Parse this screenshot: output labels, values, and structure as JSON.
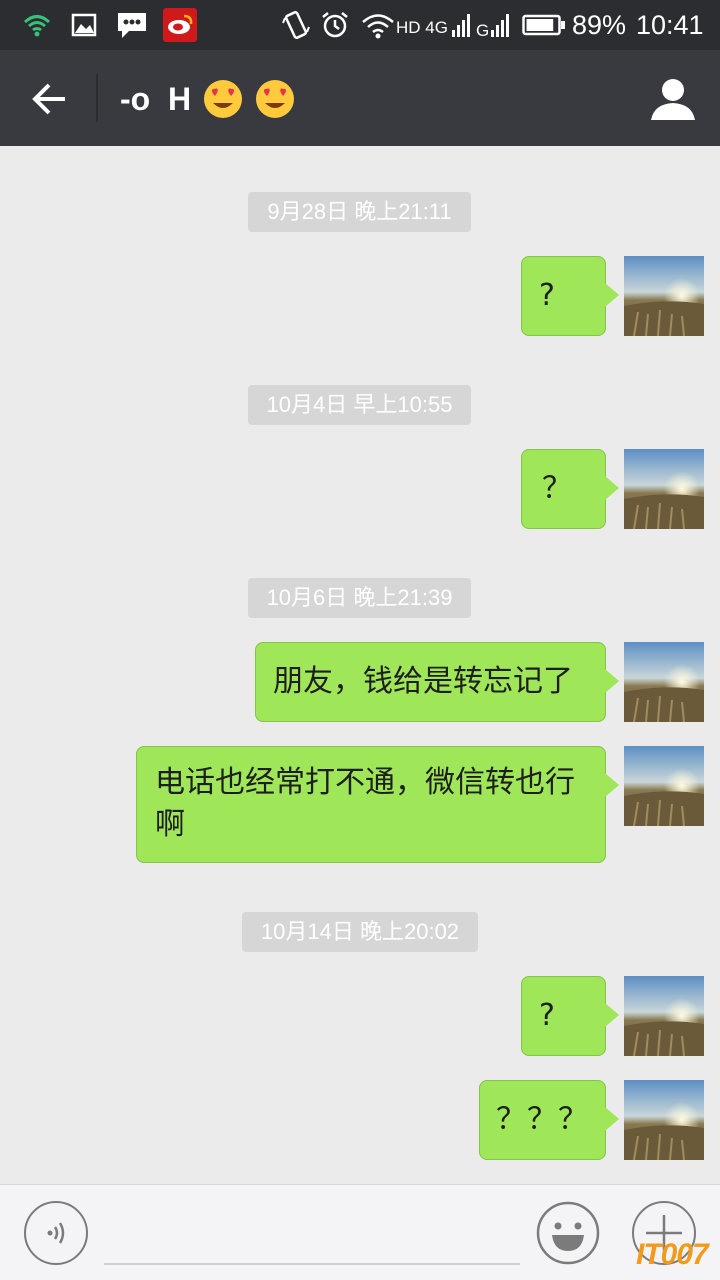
{
  "status_bar": {
    "network_label": "HD 4G",
    "battery_percent": "89%",
    "battery_level": 0.89,
    "time": "10:41",
    "icons": [
      "wifi-icon",
      "gallery-icon",
      "message-icon",
      "weibo-icon",
      "vibrate-icon",
      "alarm-icon",
      "hotspot-icon",
      "signal-icon",
      "signal-g-icon",
      "battery-icon"
    ]
  },
  "header": {
    "title": "-o  H",
    "title_emojis": [
      "heart-eyes-emoji",
      "heart-eyes-emoji"
    ],
    "back_icon": "back-arrow-icon",
    "profile_icon": "person-icon"
  },
  "chat": {
    "timestamps": [
      "9月28日 晚上21:11",
      "10月4日 早上10:55",
      "10月6日 晚上21:39",
      "10月14日 晚上20:02"
    ],
    "messages": [
      {
        "text": "?"
      },
      {
        "text": "？"
      },
      {
        "text": "朋友，钱给是转忘记了"
      },
      {
        "text": "电话也经常打不通，微信转也行啊"
      },
      {
        "text": "?"
      },
      {
        "text": "？？？"
      }
    ]
  },
  "input_bar": {
    "message_value": "",
    "voice_icon": "voice-icon",
    "emoji_icon": "smiley-icon",
    "plus_icon": "plus-icon"
  },
  "watermark": "IT007",
  "colors": {
    "header_bg": "#393a3f",
    "status_bg": "#2b2d30",
    "chat_bg": "#ebebeb",
    "bubble_green": "#9fe658",
    "timestamp_bg": "#d6d6d6"
  }
}
